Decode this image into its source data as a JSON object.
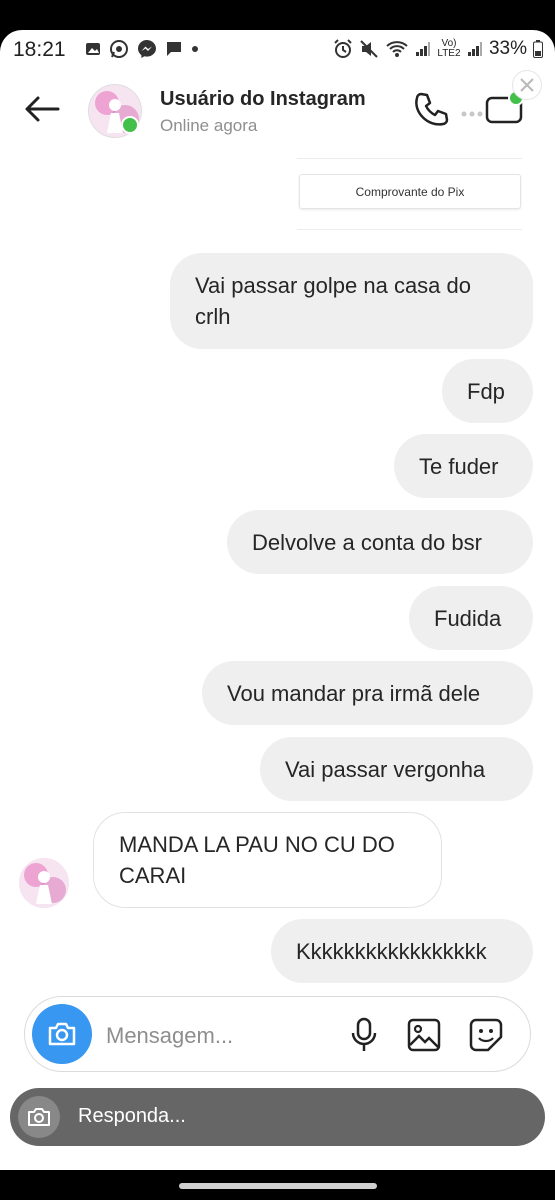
{
  "status_bar": {
    "time": "18:21",
    "volte": "Vo) LTE2",
    "battery": "33%"
  },
  "header": {
    "username": "Usuário do Instagram",
    "status": "Online agora"
  },
  "shared_post": {
    "button_label": "Comprovante do Pix"
  },
  "messages": [
    {
      "side": "out",
      "text": "Vai passar golpe na casa do crlh"
    },
    {
      "side": "out",
      "text": "Fdp"
    },
    {
      "side": "out",
      "text": "Te fuder"
    },
    {
      "side": "out",
      "text": "Delvolve a conta do bsr"
    },
    {
      "side": "out",
      "text": "Fudida"
    },
    {
      "side": "out",
      "text": "Vou mandar pra irmã dele"
    },
    {
      "side": "out",
      "text": "Vai passar vergonha"
    },
    {
      "side": "in",
      "text": "MANDA LA PAU NO CU DO CARAI"
    },
    {
      "side": "out",
      "text": "Kkkkkkkkkkkkkkkkk"
    }
  ],
  "composer": {
    "placeholder": "Mensagem..."
  },
  "quick_reply": {
    "placeholder": "Responda..."
  },
  "colors": {
    "accent": "#3897f0",
    "online": "#43c04a",
    "bubble_out": "#efefef"
  },
  "icons": [
    "back-arrow-icon",
    "phone-icon",
    "video-camera-icon",
    "camera-icon",
    "microphone-icon",
    "gallery-icon",
    "sticker-icon"
  ]
}
